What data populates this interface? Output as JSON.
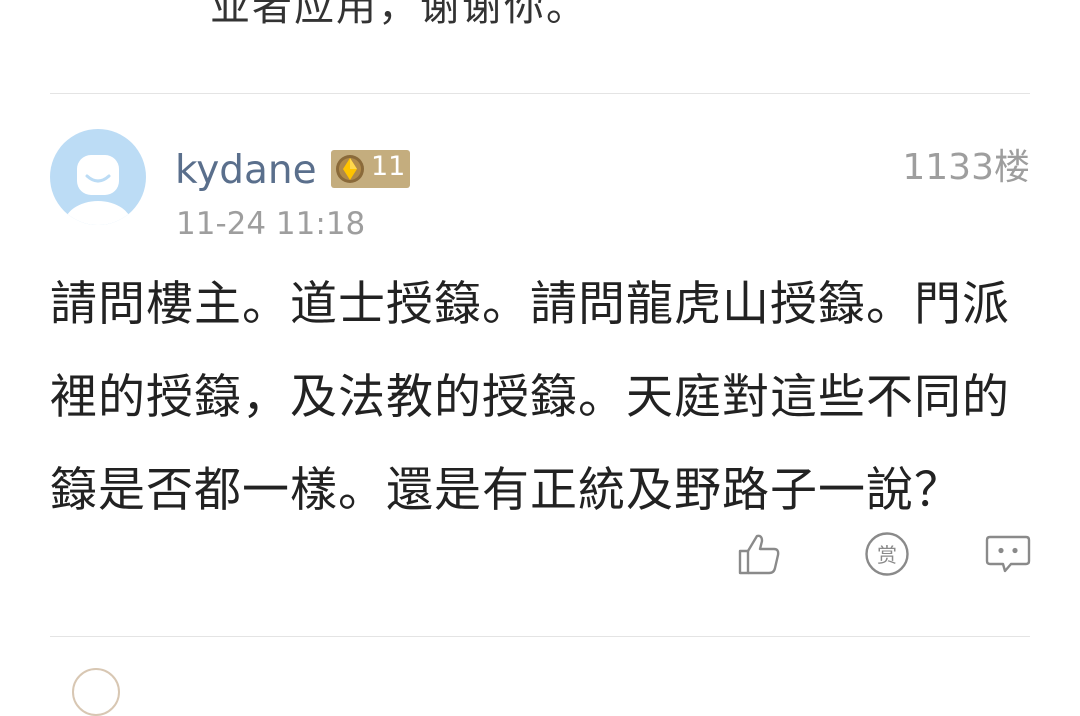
{
  "previous_post": {
    "text": "业者应用，谢谢你。"
  },
  "post": {
    "username": "kydane",
    "level": "11",
    "floor": "1133楼",
    "time": "11-24 11:18",
    "content": "請問樓主。道士授籙。請問龍虎山授籙。門派裡的授籙，及法教的授籙。天庭對這些不同的籙是否都一樣。還是有正統及野路子一說？",
    "actions": [
      {
        "icon": "thumbs-up-icon",
        "label": "like"
      },
      {
        "icon": "reward-icon",
        "label": "赏"
      },
      {
        "icon": "comment-icon",
        "label": "comment"
      }
    ]
  },
  "colors": {
    "username": "#5a6f8c",
    "badge": "#c4ad7e",
    "meta": "#9e9e9e",
    "text": "#222222",
    "divider": "#e4e4e4",
    "avatar_bg": "#bcdcf5",
    "icon": "#8a8a8a"
  }
}
